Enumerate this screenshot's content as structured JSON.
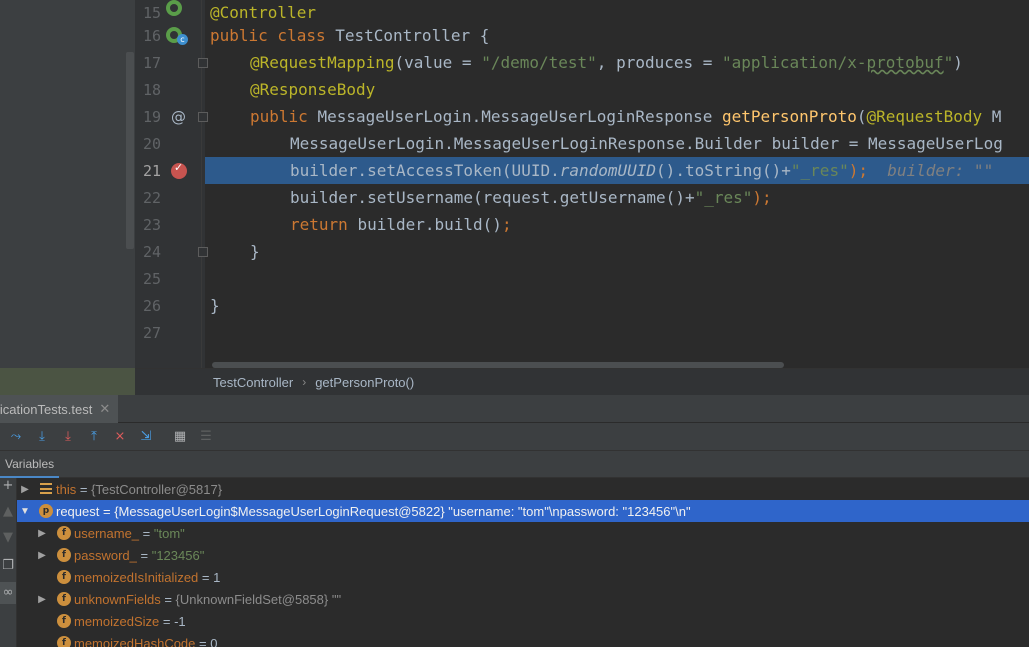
{
  "editor": {
    "lines": [
      {
        "num": "15",
        "kind": "controller"
      },
      {
        "num": "16",
        "kind": "class"
      },
      {
        "num": "17",
        "kind": "mapping"
      },
      {
        "num": "18",
        "kind": "responsebody"
      },
      {
        "num": "19",
        "kind": "method"
      },
      {
        "num": "20",
        "kind": "builder"
      },
      {
        "num": "21",
        "kind": "current"
      },
      {
        "num": "22",
        "kind": "setusername"
      },
      {
        "num": "23",
        "kind": "return"
      },
      {
        "num": "24",
        "kind": "close"
      },
      {
        "num": "25",
        "kind": "blank"
      },
      {
        "num": "26",
        "kind": "close2"
      },
      {
        "num": "27",
        "kind": "blank"
      }
    ],
    "code": {
      "l15_ann": "@Controller",
      "l16_kw": "public class ",
      "l16_rest": "TestController {",
      "l17_ann": "@RequestMapping",
      "l17_a": "(value = ",
      "l17_str1": "\"/demo/test\"",
      "l17_b": ", produces = ",
      "l17_str2a": "\"application/x-",
      "l17_str2b": "protobuf",
      "l17_str2c": "\"",
      "l17_c": ")",
      "l18_ann": "@ResponseBody",
      "l19_kw": "public ",
      "l19_type": "MessageUserLogin.MessageUserLoginResponse ",
      "l19_fn": "getPersonProto",
      "l19_paren": "(",
      "l19_ann": "@RequestBody ",
      "l19_rest": "M",
      "l20_text": "MessageUserLogin.MessageUserLoginResponse.Builder builder = MessageUserLog",
      "l21_a": "builder.setAccessToken(UUID.",
      "l21_it": "randomUUID",
      "l21_b": "().toString()+",
      "l21_str": "\"_res\"",
      "l21_semi": ");",
      "l21_hint": "  builder: \"\"",
      "l22_a": "builder.setUsername(request.getUsername()+",
      "l22_str": "\"_res\"",
      "l22_semi": ");",
      "l23_kw": "return ",
      "l23_rest": "builder.build()",
      "l23_semi": ";",
      "l24_text": "}",
      "l26_text": "}"
    },
    "gutter_icons": {
      "l15": "spring-bean-icon",
      "l16": "spring-bean-class-icon",
      "l19": "at-annotation-icon",
      "l21": "breakpoint-icon"
    }
  },
  "breadcrumb": {
    "items": [
      "TestController",
      "getPersonProto()"
    ]
  },
  "debug": {
    "session_tab": "licationTests.test",
    "close_glyph": "✕",
    "toolbar_icons": [
      "show-execution-point-icon",
      "step-over-icon",
      "step-into-icon",
      "force-step-into-icon",
      "step-out-icon",
      "drop-frame-icon",
      "run-to-cursor-icon",
      "evaluate-expression-icon",
      "trace-icon"
    ],
    "variables_tab": "Variables",
    "variables": [
      {
        "name": "this",
        "eq": " = ",
        "value": "{TestController@5817}",
        "vtype": "obj",
        "expandable": true,
        "expanded": false,
        "icon": "lines",
        "level": 0
      },
      {
        "name": "request",
        "eq": " = ",
        "value": "{MessageUserLogin$MessageUserLoginRequest@5822} \"username: \"tom\"\\npassword: \"123456\"\\n\"",
        "vtype": "obj",
        "expandable": true,
        "expanded": true,
        "icon": "p",
        "level": 0,
        "selected": true
      },
      {
        "name": "username_",
        "eq": " = ",
        "value": "\"tom\"",
        "vtype": "str",
        "expandable": true,
        "expanded": false,
        "icon": "f",
        "level": 1
      },
      {
        "name": "password_",
        "eq": " = ",
        "value": "\"123456\"",
        "vtype": "str",
        "expandable": true,
        "expanded": false,
        "icon": "f",
        "level": 1
      },
      {
        "name": "memoizedIsInitialized",
        "eq": " = ",
        "value": "1",
        "vtype": "num",
        "expandable": false,
        "icon": "f",
        "level": 1
      },
      {
        "name": "unknownFields",
        "eq": " = ",
        "value": "{UnknownFieldSet@5858} \"\"",
        "vtype": "obj",
        "expandable": true,
        "expanded": false,
        "icon": "f",
        "level": 1
      },
      {
        "name": "memoizedSize",
        "eq": " = ",
        "value": "-1",
        "vtype": "num",
        "expandable": false,
        "icon": "f",
        "level": 1
      },
      {
        "name": "memoizedHashCode",
        "eq": " = ",
        "value": "0",
        "vtype": "num",
        "expandable": false,
        "icon": "f",
        "level": 1
      }
    ]
  }
}
